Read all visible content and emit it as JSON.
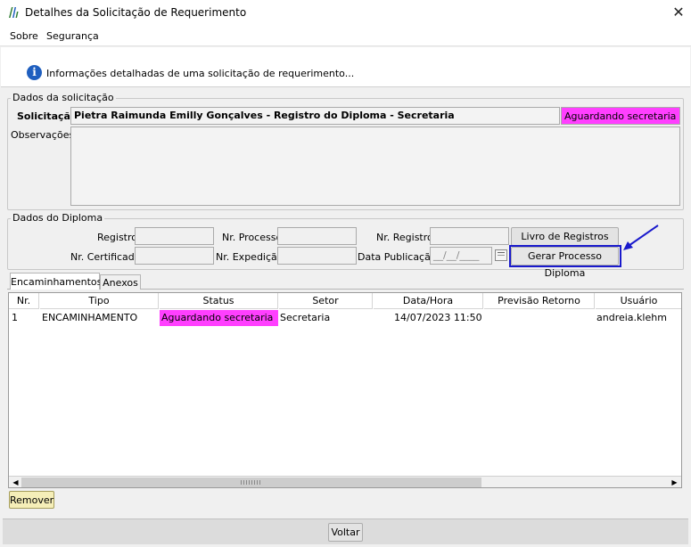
{
  "window": {
    "title": "Detalhes da Solicitação de Requerimento",
    "close_glyph": "✕"
  },
  "menu": {
    "items": [
      {
        "label": "Sobre"
      },
      {
        "label": "Segurança"
      }
    ]
  },
  "info": {
    "icon": "info-icon",
    "text": "Informações detalhadas de uma solicitação de requerimento..."
  },
  "solicitacao": {
    "group_label": "Dados da solicitação",
    "solicitacao_label": "Solicitação:",
    "solicitacao_value": "Pietra Raimunda Emilly Gonçalves - Registro do Diploma - Secretaria",
    "status_value": "Aguardando secretaria",
    "observacoes_label": "Observações:",
    "observacoes_value": ""
  },
  "diploma": {
    "group_label": "Dados do Diploma",
    "registro_label": "Registro:",
    "nr_processo_label": "Nr. Processo:",
    "nr_registro_label": "Nr. Registro:",
    "nr_certificado_label": "Nr. Certificado:",
    "nr_expedicao_label": "Nr. Expedição:",
    "data_publicacao_label": "Data Publicação:",
    "data_publicacao_placeholder": "__/__/____",
    "livro_registros_button": "Livro de Registros",
    "gerar_processo_button": "Gerar Processo Diploma"
  },
  "tabs": [
    {
      "label": "Encaminhamentos",
      "active": true
    },
    {
      "label": "Anexos",
      "active": false
    }
  ],
  "table": {
    "columns": [
      "Nr.",
      "Tipo",
      "Status",
      "Setor",
      "Data/Hora",
      "Previsão Retorno",
      "Usuário"
    ],
    "rows": [
      {
        "nr": "1",
        "tipo": "ENCAMINHAMENTO",
        "status": "Aguardando secretaria",
        "setor": "Secretaria",
        "data_hora": "14/07/2023 11:50",
        "previsao_retorno": "",
        "usuario": "andreia.klehm"
      }
    ]
  },
  "buttons": {
    "remover": "Remover",
    "voltar": "Voltar"
  },
  "colors": {
    "status_highlight": "#ff3fff",
    "annotation_blue": "#1a1acc"
  }
}
